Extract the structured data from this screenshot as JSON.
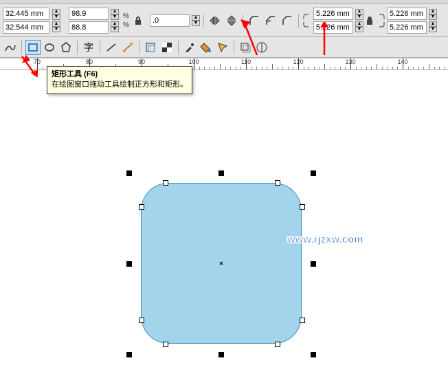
{
  "property_bar": {
    "x_value": "32.445 mm",
    "y_value": "32.544 mm",
    "scale_x": "98.9",
    "scale_y": "88.8",
    "percent": "%",
    "rotation": ".0",
    "corner_tl": "5.226 mm",
    "corner_bl": "5.226 mm",
    "corner_tr": "5.226 mm",
    "corner_br": "5.226 mm"
  },
  "tooltip": {
    "title": "矩形工具 (F6)",
    "desc": "在绘图窗口拖动工具绘制正方形和矩形。"
  },
  "ruler": {
    "unit": "70",
    "marks": [
      70,
      80,
      90,
      100,
      110,
      120,
      130,
      140
    ]
  },
  "watermark": "www.rjzxw.com",
  "icons": {
    "lock": "lock",
    "unlock": "unlock"
  }
}
